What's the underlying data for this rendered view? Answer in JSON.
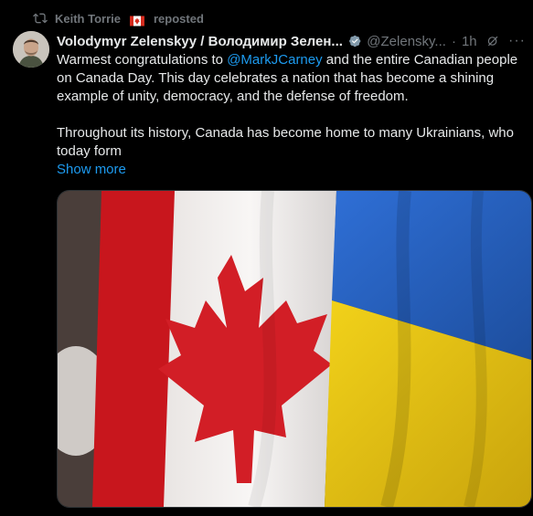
{
  "repost": {
    "text": "reposted",
    "user": "Keith Torrie",
    "icon": "repost-icon"
  },
  "post": {
    "author_name": "Volodymyr Zelenskyy / Володимир Зелен...",
    "author_handle": "@Zelensky...",
    "dot": "·",
    "time": "1h",
    "paragraph1_before": "Warmest congratulations to ",
    "mention": "@MarkJCarney",
    "paragraph1_after": " and the entire Canadian people on Canada Day. This day celebrates a nation that has become a shining example of unity, democracy, and the defense of freedom.",
    "paragraph2": "Throughout its history, Canada has become home to many Ukrainians, who today form",
    "show_more": "Show more",
    "more_menu": "···"
  },
  "colors": {
    "link": "#1d9bf0",
    "muted": "#71767b",
    "text": "#e7e9ea",
    "background": "#000000"
  }
}
